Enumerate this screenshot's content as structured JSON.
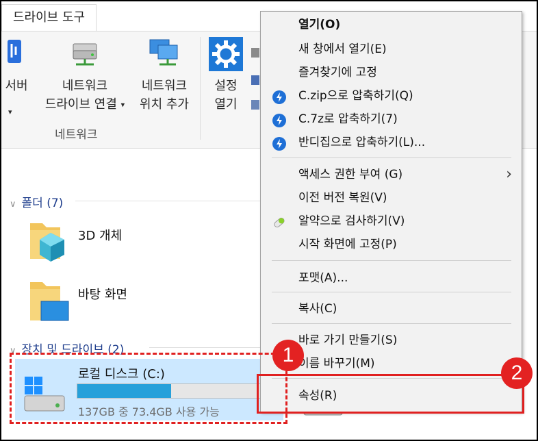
{
  "ribbon": {
    "tab_label": "드라이브 도구",
    "buttons": {
      "server_partial_line1": "서버",
      "map_drive_line1": "네트워크",
      "map_drive_line2": "드라이브 연결",
      "add_location_line1": "네트워크",
      "add_location_line2": "위치 추가",
      "settings_line1": "설정",
      "settings_line2": "열기"
    },
    "group_label": "네트워크"
  },
  "content": {
    "folders_header": "폴더 (7)",
    "folders": [
      {
        "name": "3D 개체"
      },
      {
        "name": "바탕 화면"
      }
    ],
    "drives_header": "장치 및 드라이브 (2)",
    "drive_c": {
      "name": "로컬 디스크 (C:)",
      "free_text": "137GB 중 73.4GB 사용 가능",
      "used_fraction": 0.46
    }
  },
  "context_menu": {
    "items": [
      {
        "label": "열기(O)",
        "bold": true
      },
      {
        "label": "새 창에서 열기(E)"
      },
      {
        "label": "즐겨찾기에 고정"
      },
      {
        "label": "C.zip으로 압축하기(Q)",
        "icon": "bandizip-icon"
      },
      {
        "label": "C.7z로 압축하기(7)",
        "icon": "bandizip-icon"
      },
      {
        "label": "반디집으로 압축하기(L)...",
        "icon": "bandizip-icon"
      },
      {
        "label": "액세스 권한 부여 (G)",
        "submenu": true
      },
      {
        "label": "이전 버전 복원(V)"
      },
      {
        "label": "알약으로 검사하기(V)",
        "icon": "alyac-icon"
      },
      {
        "label": "시작 화면에 고정(P)"
      },
      {
        "label": "포맷(A)..."
      },
      {
        "label": "복사(C)"
      },
      {
        "label": "바로 가기 만들기(S)"
      },
      {
        "label": "이름 바꾸기(M)"
      },
      {
        "label": "속성(R)"
      }
    ]
  },
  "annotations": {
    "badge1": "1",
    "badge2": "2"
  },
  "colors": {
    "accent_red": "#e02020",
    "selection_blue": "#cce8ff",
    "drive_bar_fill": "#26a0da",
    "section_header": "#1e3d8c"
  }
}
